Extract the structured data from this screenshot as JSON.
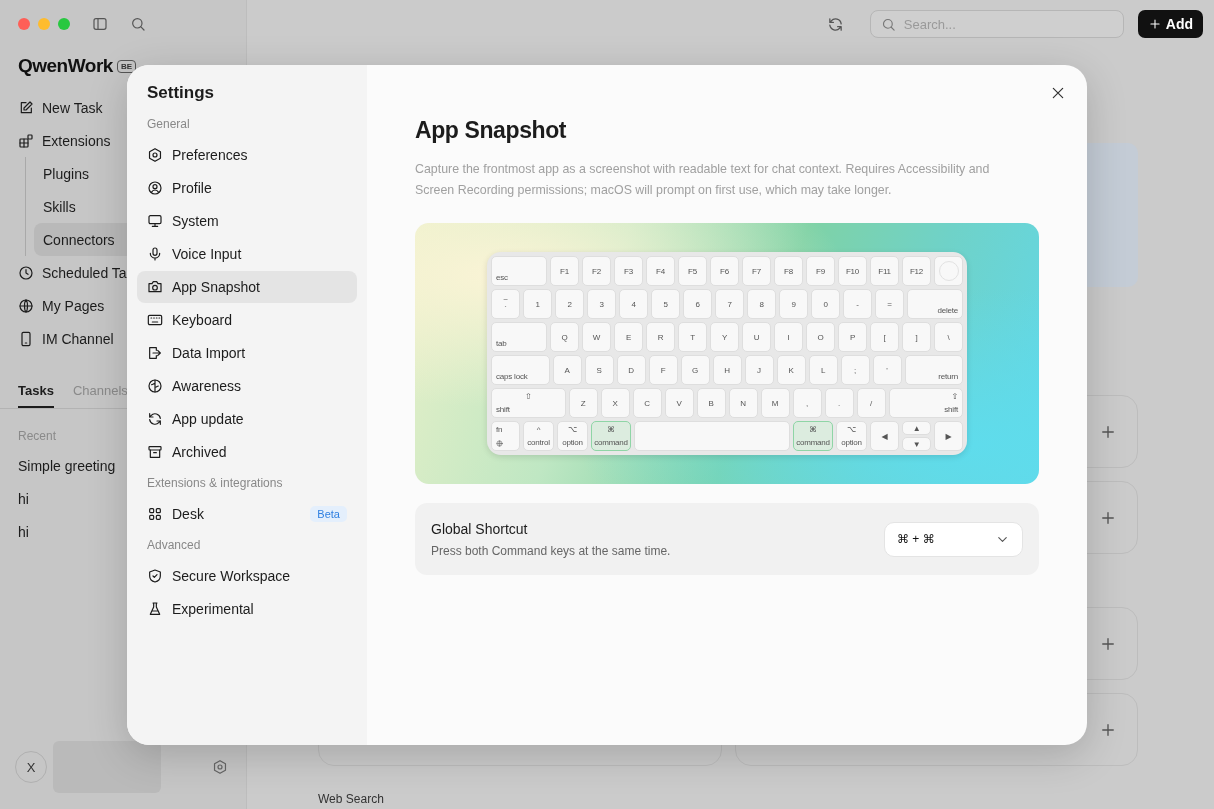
{
  "sidebar": {
    "logo": "QwenWork",
    "logo_badge": "BE",
    "items": [
      {
        "label": "New Task",
        "selected": false
      },
      {
        "label": "Extensions",
        "selected": false,
        "children": [
          {
            "label": "Plugins",
            "selected": false
          },
          {
            "label": "Skills",
            "selected": false
          },
          {
            "label": "Connectors",
            "selected": true
          }
        ]
      },
      {
        "label": "Scheduled Ta",
        "selected": false
      },
      {
        "label": "My Pages",
        "selected": false
      },
      {
        "label": "IM Channel",
        "selected": false
      }
    ],
    "tabs": [
      {
        "label": "Tasks",
        "selected": true
      },
      {
        "label": "Channels",
        "selected": false
      }
    ],
    "recent_label": "Recent",
    "recent": [
      {
        "label": "Simple greeting",
        "selected": false
      },
      {
        "label": "hi",
        "selected": false
      },
      {
        "label": "hi",
        "selected": false
      }
    ],
    "avatar": "X"
  },
  "toolbar": {
    "search": {
      "placeholder": "Search..."
    },
    "add_button": "Add"
  },
  "main": {
    "section_label": "Web Search"
  },
  "settings": {
    "title": "Settings",
    "sections": [
      {
        "label": "General",
        "items": [
          {
            "label": "Preferences",
            "selected": false
          },
          {
            "label": "Profile",
            "selected": false
          },
          {
            "label": "System",
            "selected": false
          },
          {
            "label": "Voice Input",
            "selected": false
          },
          {
            "label": "App Snapshot",
            "selected": true
          },
          {
            "label": "Keyboard",
            "selected": false
          },
          {
            "label": "Data Import",
            "selected": false
          },
          {
            "label": "Awareness",
            "selected": false
          },
          {
            "label": "App update",
            "selected": false
          },
          {
            "label": "Archived",
            "selected": false
          }
        ]
      },
      {
        "label": "Extensions & integrations",
        "items": [
          {
            "label": "Desk",
            "selected": false,
            "badge": "Beta"
          }
        ]
      },
      {
        "label": "Advanced",
        "items": [
          {
            "label": "Secure Workspace",
            "selected": false
          },
          {
            "label": "Experimental",
            "selected": false
          }
        ]
      }
    ],
    "page": {
      "title": "App Snapshot",
      "description": "Capture the frontmost app as a screenshot with readable text for chat context. Requires Accessibility and Screen Recording permissions; macOS will prompt on first use, which may take longer.",
      "keyboard": {
        "rows": [
          {
            "keys": [
              {
                "kind": "wide",
                "label": "esc",
                "pressed": false
              },
              {
                "kind": "key",
                "label": "F1",
                "pressed": false
              },
              {
                "kind": "key",
                "label": "F2",
                "pressed": false
              },
              {
                "kind": "key",
                "label": "F3",
                "pressed": false
              },
              {
                "kind": "key",
                "label": "F4",
                "pressed": false
              },
              {
                "kind": "key",
                "label": "F5",
                "pressed": false
              },
              {
                "kind": "key",
                "label": "F6",
                "pressed": false
              },
              {
                "kind": "key",
                "label": "F7",
                "pressed": false
              },
              {
                "kind": "key",
                "label": "F8",
                "pressed": false
              },
              {
                "kind": "key",
                "label": "F9",
                "pressed": false
              },
              {
                "kind": "key",
                "label": "F10",
                "pressed": false
              },
              {
                "kind": "key",
                "label": "F11",
                "pressed": false
              },
              {
                "kind": "key",
                "label": "F12",
                "pressed": false
              },
              {
                "kind": "touch",
                "pressed": false
              }
            ]
          },
          {
            "keys": [
              {
                "kind": "key",
                "top": "~",
                "label": "`",
                "pressed": false
              },
              {
                "kind": "key",
                "label": "1",
                "pressed": false
              },
              {
                "kind": "key",
                "label": "2",
                "pressed": false
              },
              {
                "kind": "key",
                "label": "3",
                "pressed": false
              },
              {
                "kind": "key",
                "label": "4",
                "pressed": false
              },
              {
                "kind": "key",
                "label": "5",
                "pressed": false
              },
              {
                "kind": "key",
                "label": "6",
                "pressed": false
              },
              {
                "kind": "key",
                "label": "7",
                "pressed": false
              },
              {
                "kind": "key",
                "label": "8",
                "pressed": false
              },
              {
                "kind": "key",
                "label": "9",
                "pressed": false
              },
              {
                "kind": "key",
                "label": "0",
                "pressed": false
              },
              {
                "kind": "key",
                "label": "-",
                "pressed": false
              },
              {
                "kind": "key",
                "label": "=",
                "pressed": false
              },
              {
                "kind": "wide",
                "label": "delete",
                "pressed": false
              }
            ]
          },
          {
            "keys": [
              {
                "kind": "wide",
                "label": "tab",
                "pressed": false
              },
              {
                "kind": "key",
                "label": "Q",
                "pressed": false
              },
              {
                "kind": "key",
                "label": "W",
                "pressed": false
              },
              {
                "kind": "key",
                "label": "E",
                "pressed": false
              },
              {
                "kind": "key",
                "label": "R",
                "pressed": false
              },
              {
                "kind": "key",
                "label": "T",
                "pressed": false
              },
              {
                "kind": "key",
                "label": "Y",
                "pressed": false
              },
              {
                "kind": "key",
                "label": "U",
                "pressed": false
              },
              {
                "kind": "key",
                "label": "I",
                "pressed": false
              },
              {
                "kind": "key",
                "label": "O",
                "pressed": false
              },
              {
                "kind": "key",
                "label": "P",
                "pressed": false
              },
              {
                "kind": "key",
                "label": "[",
                "pressed": false
              },
              {
                "kind": "key",
                "label": "]",
                "pressed": false
              },
              {
                "kind": "key",
                "label": "\\",
                "pressed": false
              }
            ]
          },
          {
            "keys": [
              {
                "kind": "wide",
                "label": "caps lock",
                "pressed": false
              },
              {
                "kind": "key",
                "label": "A",
                "pressed": false
              },
              {
                "kind": "key",
                "label": "S",
                "pressed": false
              },
              {
                "kind": "key",
                "label": "D",
                "pressed": false
              },
              {
                "kind": "key",
                "label": "F",
                "pressed": false
              },
              {
                "kind": "key",
                "label": "G",
                "pressed": false
              },
              {
                "kind": "key",
                "label": "H",
                "pressed": false
              },
              {
                "kind": "key",
                "label": "J",
                "pressed": false
              },
              {
                "kind": "key",
                "label": "K",
                "pressed": false
              },
              {
                "kind": "key",
                "label": "L",
                "pressed": false
              },
              {
                "kind": "key",
                "label": ";",
                "pressed": false
              },
              {
                "kind": "key",
                "label": "'",
                "pressed": false
              },
              {
                "kind": "wide",
                "label": "return",
                "pressed": false
              }
            ]
          },
          {
            "keys": [
              {
                "kind": "wide",
                "top": "⇧",
                "label": "shift",
                "pressed": false
              },
              {
                "kind": "key",
                "label": "Z",
                "pressed": false
              },
              {
                "kind": "key",
                "label": "X",
                "pressed": false
              },
              {
                "kind": "key",
                "label": "C",
                "pressed": false
              },
              {
                "kind": "key",
                "label": "V",
                "pressed": false
              },
              {
                "kind": "key",
                "label": "B",
                "pressed": false
              },
              {
                "kind": "key",
                "label": "N",
                "pressed": false
              },
              {
                "kind": "key",
                "label": "M",
                "pressed": false
              },
              {
                "kind": "key",
                "label": ",",
                "pressed": false
              },
              {
                "kind": "key",
                "label": ".",
                "pressed": false
              },
              {
                "kind": "key",
                "label": "/",
                "pressed": false
              },
              {
                "kind": "wide",
                "top": "⇧",
                "label": "shift",
                "pressed": false
              }
            ]
          },
          {
            "keys": [
              {
                "kind": "fn",
                "label": "fn",
                "pressed": false
              },
              {
                "kind": "mod",
                "top": "^",
                "label": "control",
                "pressed": false
              },
              {
                "kind": "mod",
                "top": "⌥",
                "label": "option",
                "pressed": false
              },
              {
                "kind": "cmd",
                "top": "⌘",
                "label": "command",
                "pressed": true
              },
              {
                "kind": "wide",
                "pressed": false
              },
              {
                "kind": "cmd",
                "top": "⌘",
                "label": "command",
                "pressed": true
              },
              {
                "kind": "mod",
                "top": "⌥",
                "label": "option",
                "pressed": false
              },
              {
                "kind": "key",
                "label": "◀",
                "pressed": false
              },
              {
                "kind": "updown",
                "top": "▲",
                "label": "▼",
                "pressed": false
              },
              {
                "kind": "key",
                "label": "▶",
                "pressed": false
              }
            ]
          }
        ]
      },
      "shortcut": {
        "title": "Global Shortcut",
        "description": "Press both Command keys at the same time.",
        "value": "⌘ + ⌘"
      }
    }
  }
}
